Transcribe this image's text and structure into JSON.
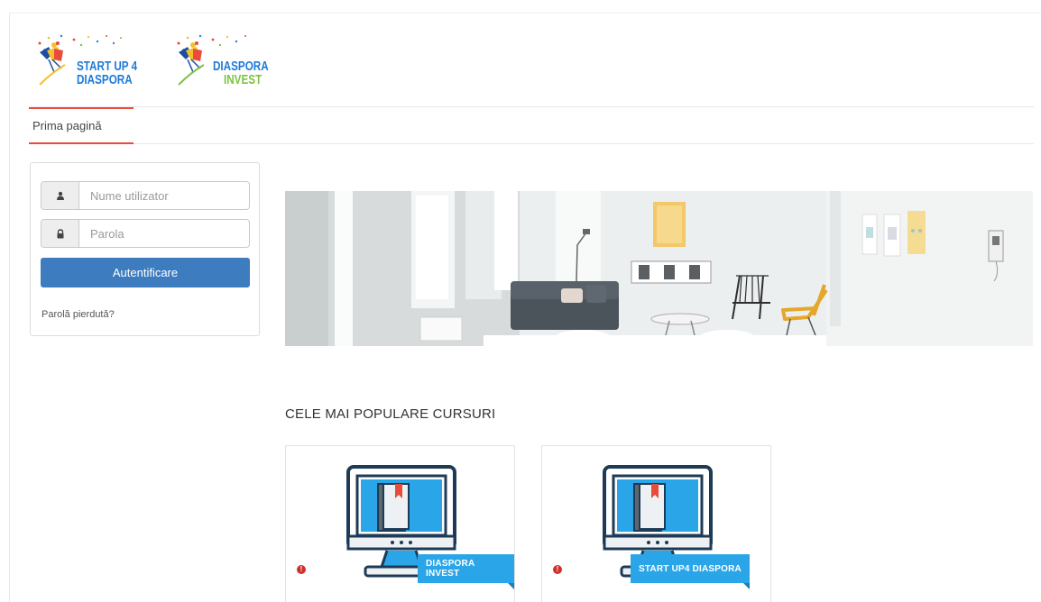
{
  "header": {
    "logos": [
      {
        "line1": "START UP 4",
        "line2": "DIASPORA"
      },
      {
        "line1": "DIASPORA",
        "line2": "INVEST"
      }
    ]
  },
  "nav": {
    "items": [
      {
        "label": "Prima pagină",
        "active": true
      }
    ]
  },
  "login": {
    "username_placeholder": "Nume utilizator",
    "password_placeholder": "Parola",
    "submit_label": "Autentificare",
    "lost_password_label": "Parolă pierdută?",
    "user_icon": "user-icon",
    "lock_icon": "lock-icon"
  },
  "main": {
    "section_title": "CELE MAI POPULARE CURSURI",
    "courses": [
      {
        "badge": "DIASPORA INVEST",
        "icon": "monitor-book-icon"
      },
      {
        "badge": "START UP4 DIASPORA",
        "icon": "monitor-book-icon"
      }
    ]
  },
  "colors": {
    "accent": "#e64b3b",
    "button": "#3d7cbf",
    "badge": "#2aa6e8",
    "info": "#d0302a",
    "logo_blue": "#1c7ad8",
    "logo_green": "#7cc242"
  }
}
